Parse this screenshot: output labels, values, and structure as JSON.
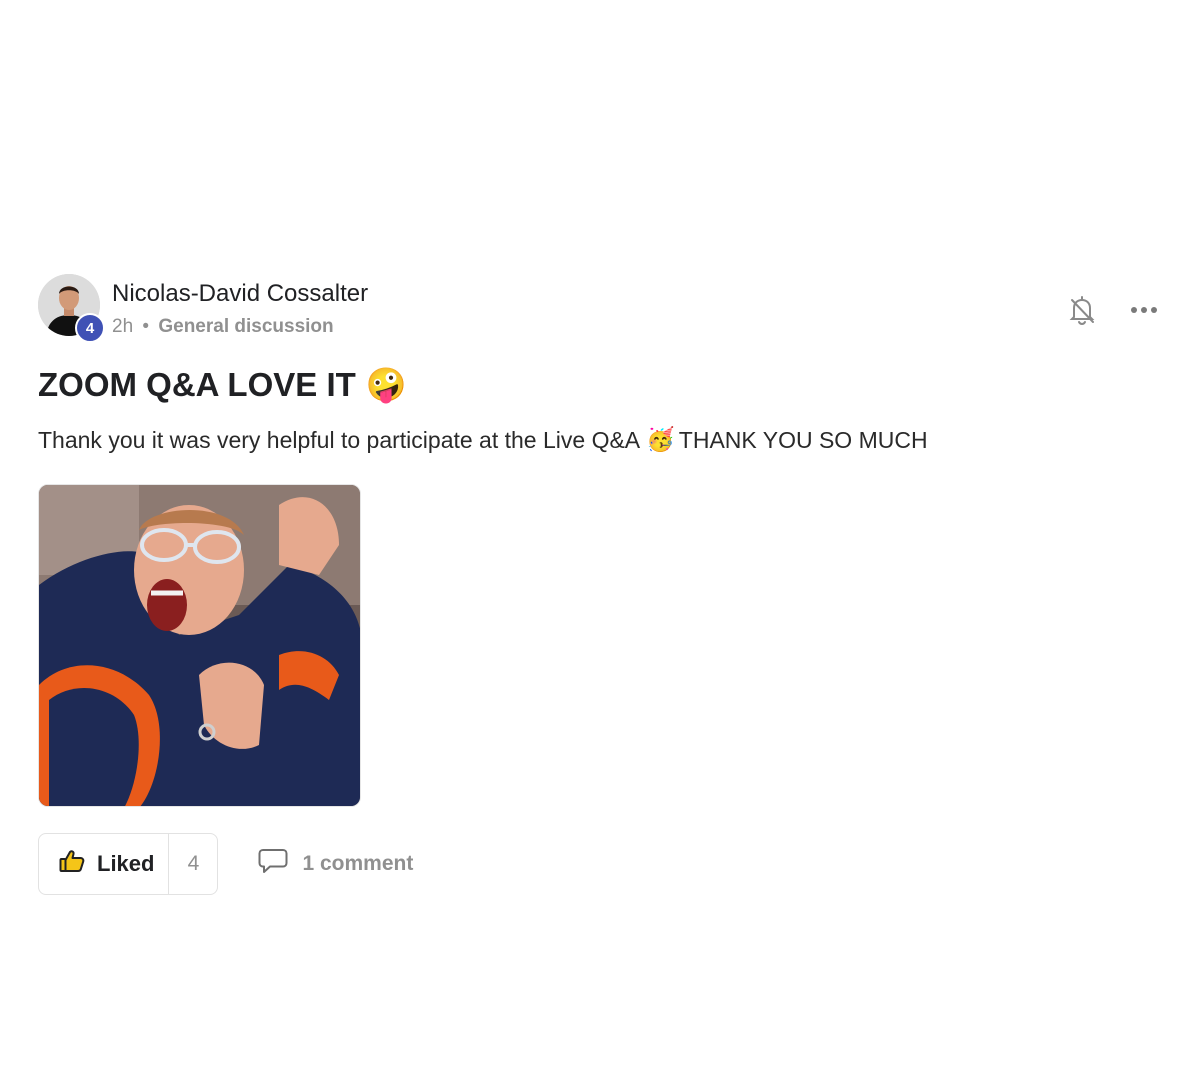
{
  "post": {
    "author": "Nicolas-David Cossalter",
    "level": "4",
    "time": "2h",
    "separator": "•",
    "category": "General discussion",
    "title": "ZOOM Q&A LOVE IT",
    "title_emoji": "🤪",
    "body_before": "Thank you it was very helpful to participate at the Live Q&A",
    "body_emoji": "🥳",
    "body_after": "THANK YOU SO MUCH"
  },
  "actions": {
    "like_label": "Liked",
    "like_count": "4",
    "comment_label": "1 comment"
  },
  "icons": {
    "notifications": "bell-off-icon",
    "more": "more-horizontal-icon",
    "like": "thumbs-up-icon",
    "comment": "comment-bubble-icon"
  },
  "colors": {
    "level_badge": "#3f51b5",
    "meta_text": "#909090"
  }
}
